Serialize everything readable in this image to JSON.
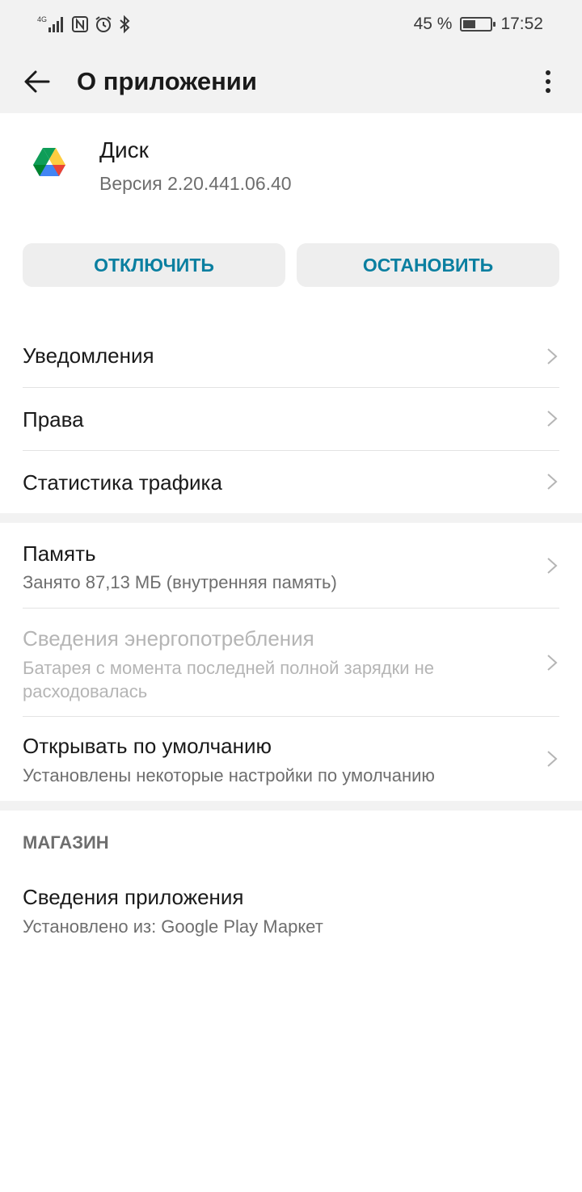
{
  "status_bar": {
    "network": "4G",
    "battery_percent": "45 %",
    "battery_level": 0.45,
    "time": "17:52"
  },
  "appbar": {
    "title": "О приложении"
  },
  "app": {
    "name": "Диск",
    "version": "Версия 2.20.441.06.40"
  },
  "buttons": {
    "disable": "ОТКЛЮЧИТЬ",
    "stop": "ОСТАНОВИТЬ"
  },
  "settings": {
    "notifications": "Уведомления",
    "permissions": "Права",
    "traffic": "Статистика трафика",
    "storage": {
      "title": "Память",
      "subtitle": "Занято 87,13 МБ (внутренняя память)"
    },
    "battery": {
      "title": "Сведения энергопотребления",
      "subtitle": "Батарея с момента последней полной зарядки не расходовалась"
    },
    "open_default": {
      "title": "Открывать по умолчанию",
      "subtitle": "Установлены некоторые настройки по умолчанию"
    }
  },
  "store": {
    "section_label": "МАГАЗИН",
    "app_details": {
      "title": "Сведения приложения",
      "subtitle": "Установлено из: Google Play Маркет"
    }
  },
  "colors": {
    "accent": "#0a7fa0",
    "background": "#ffffff",
    "bar": "#f2f2f2"
  }
}
